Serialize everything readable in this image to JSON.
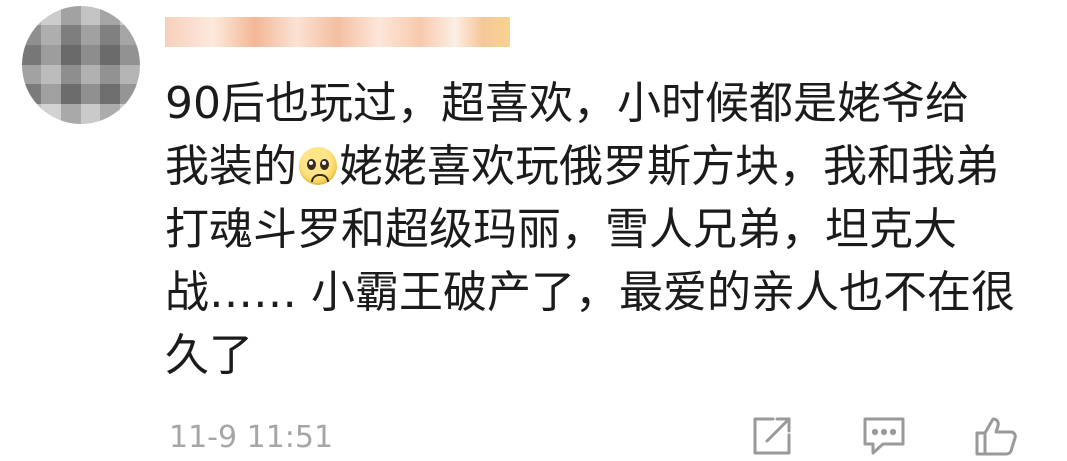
{
  "user": {
    "name": "",
    "avatar": "avatar"
  },
  "comment": {
    "text_before_emoji": "90后也玩过，超喜欢，小时候都是姥爷给\n我装的",
    "emoji": "worried-face-emoji",
    "text_after_emoji": "姥姥喜欢玩俄罗斯方块，我和我弟\n打魂斗罗和超级玛丽，雪人兄弟，坦克大\n战…… 小霸王破产了，最爱的亲人也不在很\n久了"
  },
  "meta": {
    "timestamp": "11-9 11:51"
  },
  "actions": [
    {
      "icon": "share-icon"
    },
    {
      "icon": "reply-icon"
    },
    {
      "icon": "like-icon"
    }
  ],
  "colors": {
    "text": "#1b1b1b",
    "meta": "#a6a6a6",
    "icon": "#9a9a9a"
  }
}
